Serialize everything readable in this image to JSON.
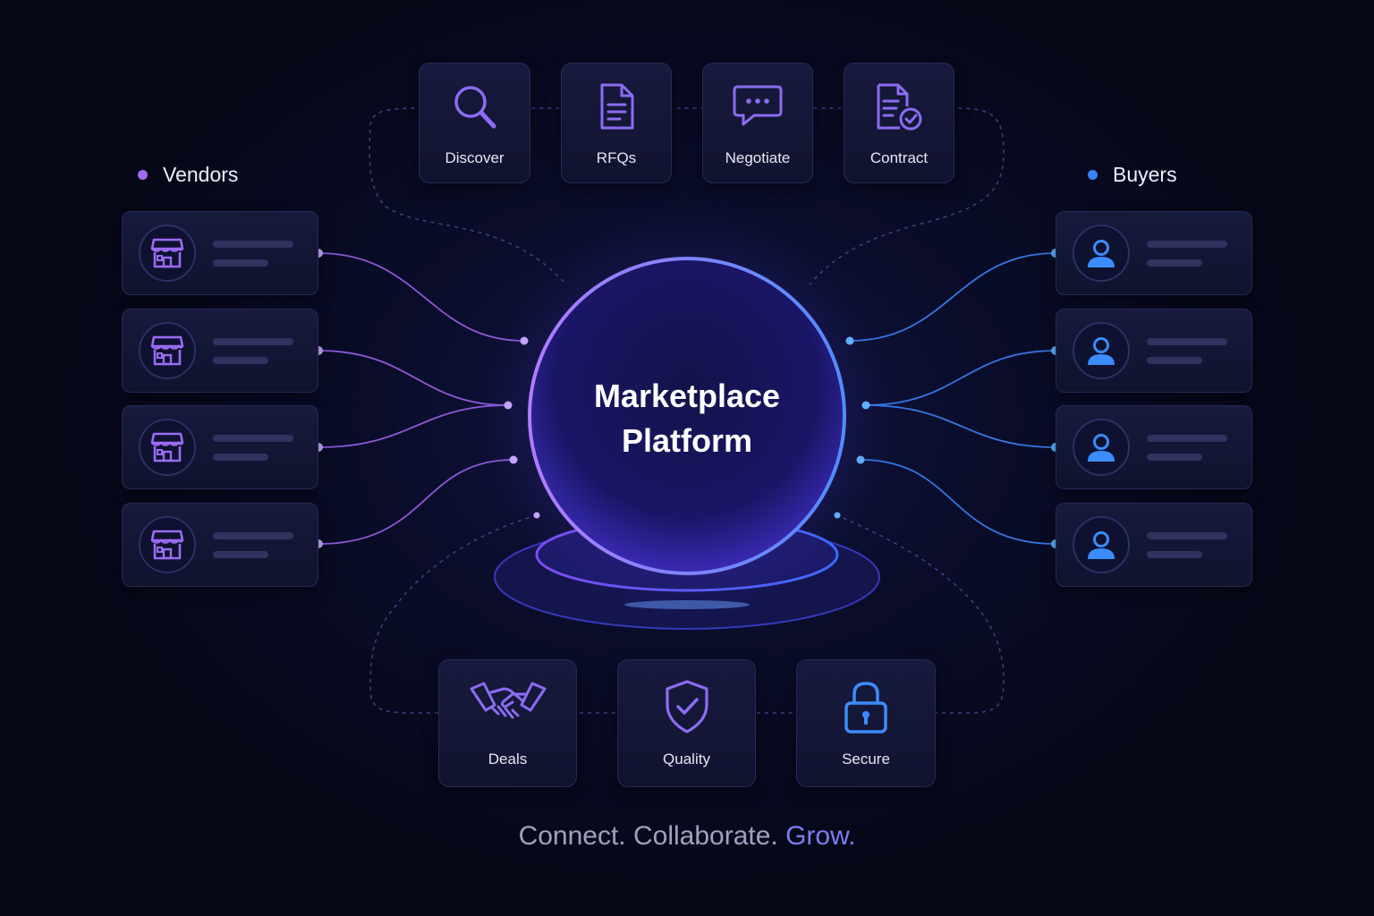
{
  "hub": {
    "line1": "Marketplace",
    "line2": "Platform"
  },
  "vendors": {
    "title": "Vendors",
    "dot_color": "#a46cf0",
    "icon": "storefront-icon",
    "count_cards": 4
  },
  "buyers": {
    "title": "Buyers",
    "dot_color": "#3b82f6",
    "icon": "user-icon",
    "count_cards": 4
  },
  "top_steps": [
    {
      "label": "Discover",
      "icon": "magnifier-icon"
    },
    {
      "label": "RFQs",
      "icon": "document-icon"
    },
    {
      "label": "Negotiate",
      "icon": "chat-bubble-icon"
    },
    {
      "label": "Contract",
      "icon": "contract-check-icon"
    }
  ],
  "bottom_steps": [
    {
      "label": "Deals",
      "icon": "handshake-icon"
    },
    {
      "label": "Quality",
      "icon": "shield-check-icon"
    },
    {
      "label": "Secure",
      "icon": "padlock-icon"
    }
  ],
  "tagline": {
    "part1": "Connect. Collaborate.",
    "part2": "Grow."
  },
  "colors": {
    "vendor_accent": "#a46cf0",
    "buyer_accent": "#3b82f6",
    "icon_purple": "#8b6cf2",
    "background": "#070a1f"
  }
}
